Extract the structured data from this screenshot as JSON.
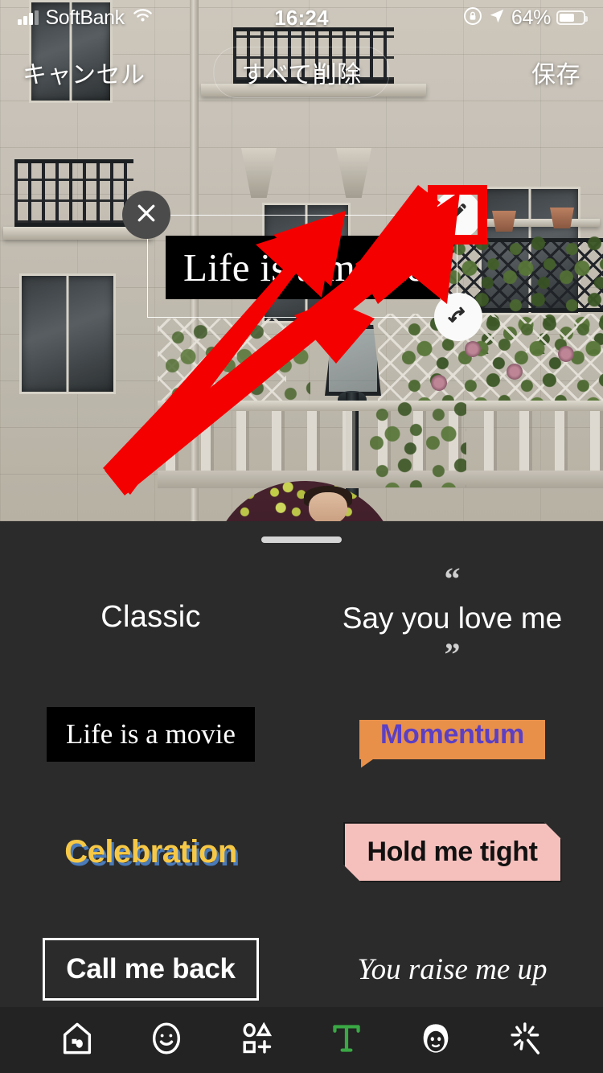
{
  "status_bar": {
    "carrier": "SoftBank",
    "time": "16:24",
    "battery_percent": "64%",
    "signal_icon": "cellular-bars-icon",
    "wifi_icon": "wifi-icon",
    "lock_icon": "rotation-lock-icon",
    "location_icon": "location-arrow-icon",
    "battery_icon": "battery-icon"
  },
  "top_nav": {
    "cancel_label": "キャンセル",
    "delete_all_label": "すべて削除",
    "save_label": "保存"
  },
  "canvas": {
    "overlay_text": "Life is a movie",
    "close_icon": "close-x-icon",
    "edit_icon": "pencil-edit-icon",
    "rotate_icon": "rotate-resize-icon",
    "highlight_color": "#f40000",
    "annotation_arrow": "red-arrow-pointer"
  },
  "sheet": {
    "grabber": "drag-handle",
    "background_color": "#2b2b2b",
    "styles": [
      {
        "id": "classic",
        "label": "Classic"
      },
      {
        "id": "quote",
        "label": "Say you love me",
        "quote_open": "“",
        "quote_close": "”"
      },
      {
        "id": "black-box",
        "label": "Life is a movie"
      },
      {
        "id": "bubble",
        "label": "Momentum",
        "bg_color": "#e8904a",
        "text_color": "#5b3fc4"
      },
      {
        "id": "celebration",
        "label": "Celebration",
        "text_color": "#f6c846",
        "shadow_color": "#4a7ab8"
      },
      {
        "id": "banner",
        "label": "Hold me tight",
        "bg_color": "#f5c0bc",
        "text_color": "#111111"
      },
      {
        "id": "outline-box",
        "label": "Call me back"
      },
      {
        "id": "rule-italic",
        "label": "You raise me up"
      }
    ]
  },
  "toolbar": {
    "active_color": "#3aa845",
    "items": [
      {
        "id": "sticker",
        "icon": "house-sticker-icon",
        "active": false
      },
      {
        "id": "emoji",
        "icon": "smiley-face-icon",
        "active": false
      },
      {
        "id": "shapes",
        "icon": "shapes-icon",
        "active": false
      },
      {
        "id": "text",
        "icon": "text-t-icon",
        "active": true
      },
      {
        "id": "avatar",
        "icon": "face-avatar-icon",
        "active": false
      },
      {
        "id": "effects",
        "icon": "sparkle-icon",
        "active": false
      }
    ]
  }
}
